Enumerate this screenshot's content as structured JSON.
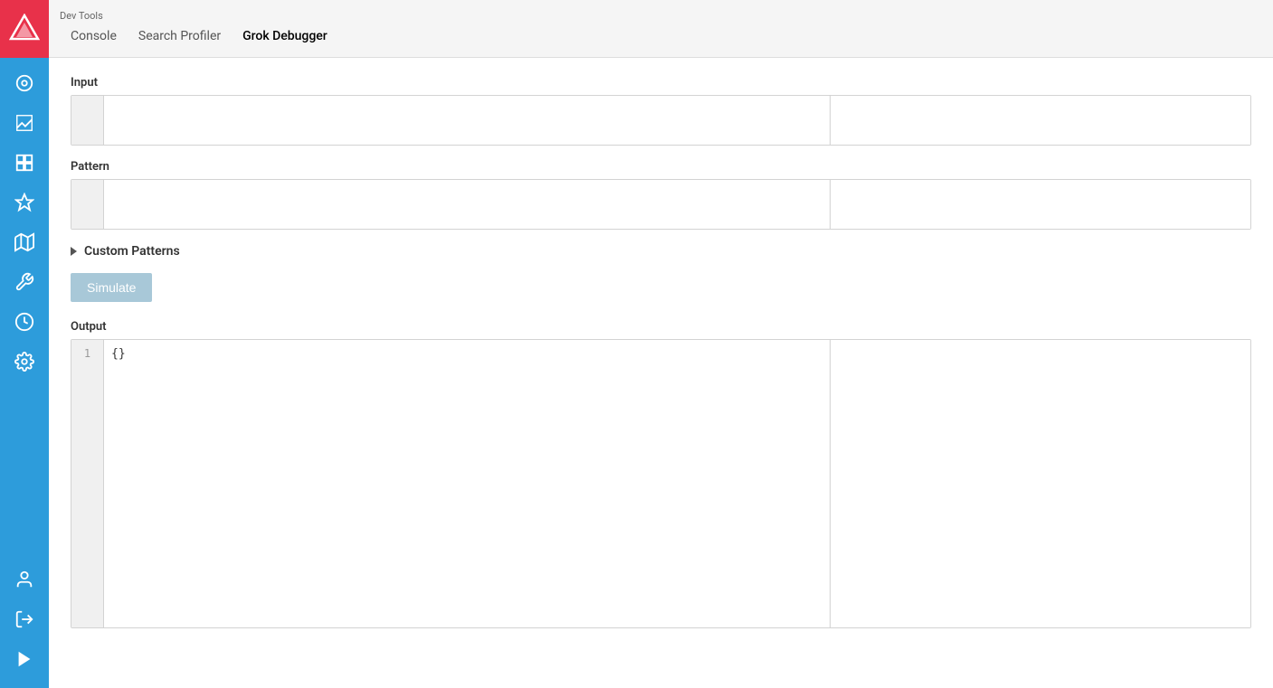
{
  "topbar": {
    "app_name": "Dev Tools",
    "nav": [
      {
        "label": "Console",
        "active": false
      },
      {
        "label": "Search Profiler",
        "active": false
      },
      {
        "label": "Grok Debugger",
        "active": true
      }
    ]
  },
  "sidebar": {
    "icons": [
      {
        "name": "discover-icon",
        "symbol": "◎"
      },
      {
        "name": "visualize-icon",
        "symbol": "📊"
      },
      {
        "name": "dashboard-icon",
        "symbol": "⊞"
      },
      {
        "name": "canvas-icon",
        "symbol": "✦"
      },
      {
        "name": "map-icon",
        "symbol": "✱"
      },
      {
        "name": "devtools-icon",
        "symbol": "🔧"
      },
      {
        "name": "monitoring-icon",
        "symbol": "◉"
      },
      {
        "name": "settings-icon",
        "symbol": "⚙"
      }
    ],
    "bottom_icons": [
      {
        "name": "user-icon",
        "symbol": "👤"
      },
      {
        "name": "logout-icon",
        "symbol": "⬏"
      },
      {
        "name": "play-icon",
        "symbol": "▶"
      }
    ]
  },
  "main": {
    "input_label": "Input",
    "pattern_label": "Pattern",
    "custom_patterns_label": "Custom Patterns",
    "simulate_button": "Simulate",
    "output_label": "Output",
    "output_line1": "{}",
    "output_line_number": "1"
  }
}
